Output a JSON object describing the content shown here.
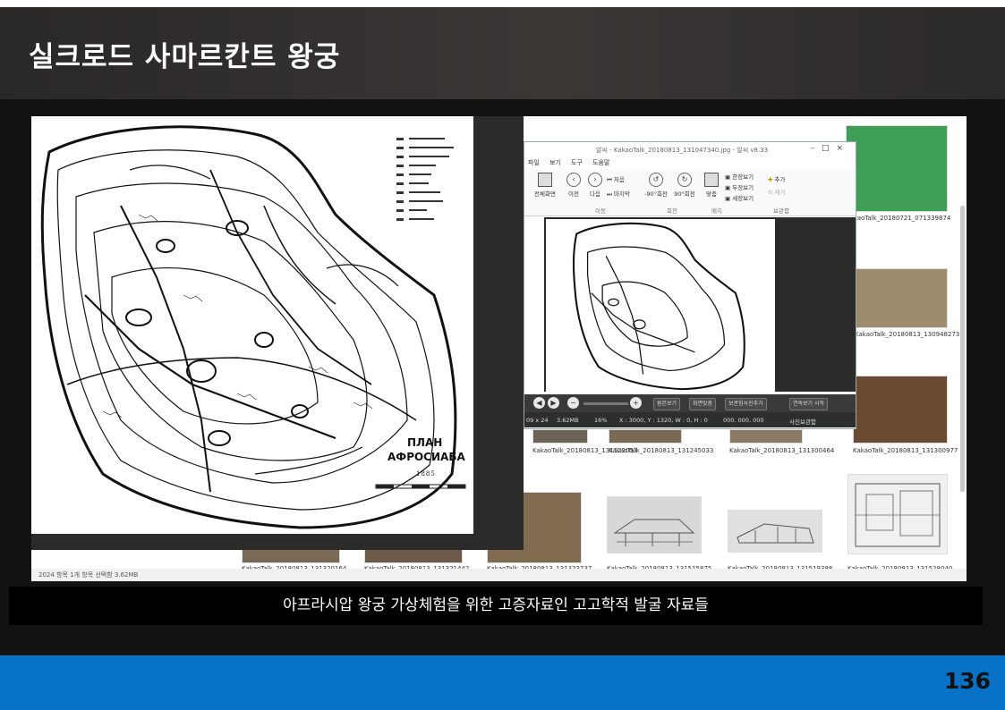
{
  "slide": {
    "title": "실크로드 사마르칸트 왕궁",
    "caption": "아프라시압 왕궁 가상체험을 위한 고증자료인 고고학적 발굴 자료들",
    "page_number": "136"
  },
  "map": {
    "title_line1": "ПЛАН",
    "title_line2": "АФРОСИАБА",
    "year": "1885"
  },
  "viewer": {
    "window_title": "알씨 - KakaoTalk_20180813_131047340.jpg - 알씨 v8.33",
    "menu": [
      "파일",
      "보기",
      "도구",
      "도움말"
    ],
    "ribbon": {
      "fullscreen": "전체화면",
      "prev": "이전",
      "next": "다음",
      "first": "처음",
      "last": "마지막",
      "rotate_left": "-90°회전",
      "rotate_right": "90°회전",
      "fit": "맞춤",
      "view_one": "한장보기",
      "view_multi": "두장보기",
      "view_list": "세장보기",
      "add": "추가",
      "remove": "제거",
      "group_move": "이동",
      "group_rotate": "회전",
      "group_arrange": "배치",
      "group_edit": "보관함"
    },
    "toolbar": {
      "actual_size": "원본보기",
      "fit_screen": "화면맞춤",
      "save_to_box": "보관함사진추가",
      "slideshow": "연속보기 시작"
    },
    "info": {
      "dims": "09 x 24",
      "size": "3.62MB",
      "zoom": "16%",
      "coords": "X : 3000, Y : 1320, W : 0, H : 0",
      "color": "000, 000, 000",
      "box": "사진보관함"
    }
  },
  "thumbnails": [
    {
      "caption": "KakaoTalk_20180721_071339874",
      "color": "#3f9e55"
    },
    {
      "caption": "KakaoTalk_20180813_130948273",
      "color": "#9c8b6d"
    },
    {
      "caption": "KakaoTalk_20180813_131122053",
      "color": "#6b6258"
    },
    {
      "caption": "KakaoTalk_20180813_131245033",
      "color": "#7a6a55"
    },
    {
      "caption": "KakaoTalk_20180813_131300464",
      "color": "#8a7a66"
    },
    {
      "caption": "KakaoTalk_20180813_131300977",
      "color": "#6b4a32"
    },
    {
      "caption": "KakaoTalk_20180813_131320164",
      "color": "#7a6a55"
    },
    {
      "caption": "KakaoTalk_20180813_131321442",
      "color": "#6b5a48"
    },
    {
      "caption": "KakaoTalk_20180813_131323737",
      "color": "#806a50"
    },
    {
      "caption": "KakaoTalk_20180813_131515875",
      "color": "#d8d8d8"
    },
    {
      "caption": "KakaoTalk_20180813_131519388",
      "color": "#e0e0e0"
    },
    {
      "caption": "KakaoTalk_20180813_131528040",
      "color": "#f0f0f0"
    }
  ],
  "explorer_status": "2024 항목   1개 항목 선택함 3.62MB",
  "colors": {
    "header_bg": "#2f2d2c",
    "footer_bg": "#0772c6",
    "caption_bg": "#000000"
  }
}
